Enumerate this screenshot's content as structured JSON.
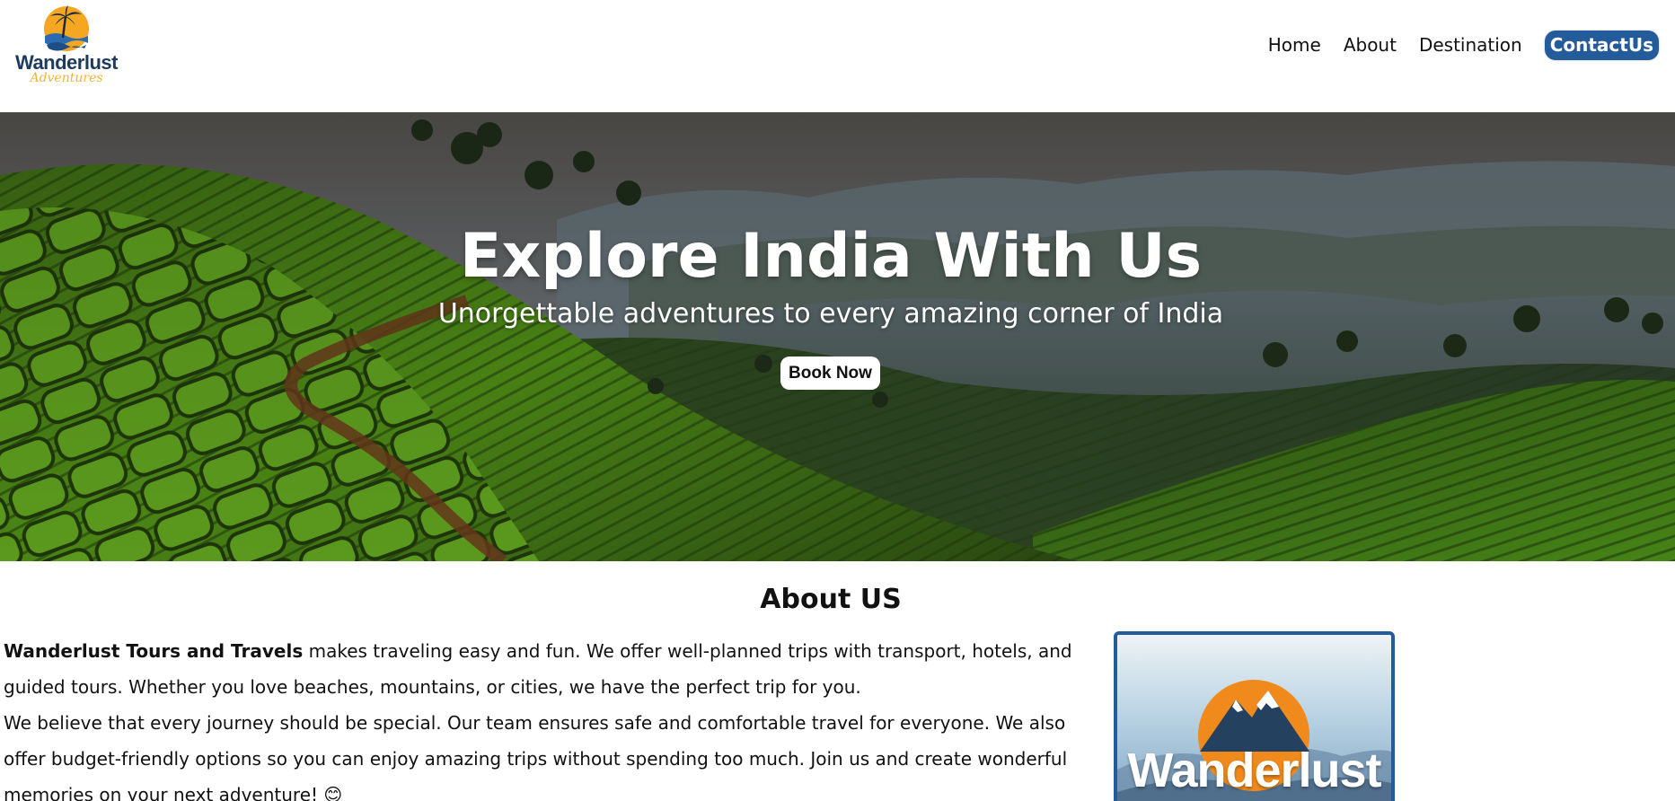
{
  "header": {
    "logo_title": "Wanderlust",
    "logo_subtitle": "Adventures",
    "nav": [
      {
        "label": "Home"
      },
      {
        "label": "About"
      },
      {
        "label": "Destination"
      },
      {
        "label": "ContactUs"
      }
    ]
  },
  "hero": {
    "title": "Explore India With Us",
    "subtitle": "Unorgettable adventures to every amazing corner of India",
    "cta_label": "Book Now"
  },
  "about": {
    "heading": "About US",
    "company_name": "Wanderlust Tours and Travels",
    "paragraph1_rest": " makes traveling easy and fun. We offer well-planned trips with transport, hotels, and guided tours. Whether you love beaches, mountains, or cities, we have the perfect trip for you.",
    "paragraph2": "We believe that every journey should be special. Our team ensures safe and comfortable travel for everyone. We also offer budget-friendly options so you can enjoy amazing trips without spending too much. Join us and create wonderful memories on your next adventure! 😊",
    "card_word": "Wanderlust"
  },
  "colors": {
    "brand_blue": "#245b9b",
    "logo_sun": "#f5a623",
    "logo_navy": "#1d3b5c",
    "card_orange": "#f08a1c"
  },
  "icons": {
    "logo": "palm-sun-logo-icon",
    "emoji": "smiling-face-icon"
  }
}
